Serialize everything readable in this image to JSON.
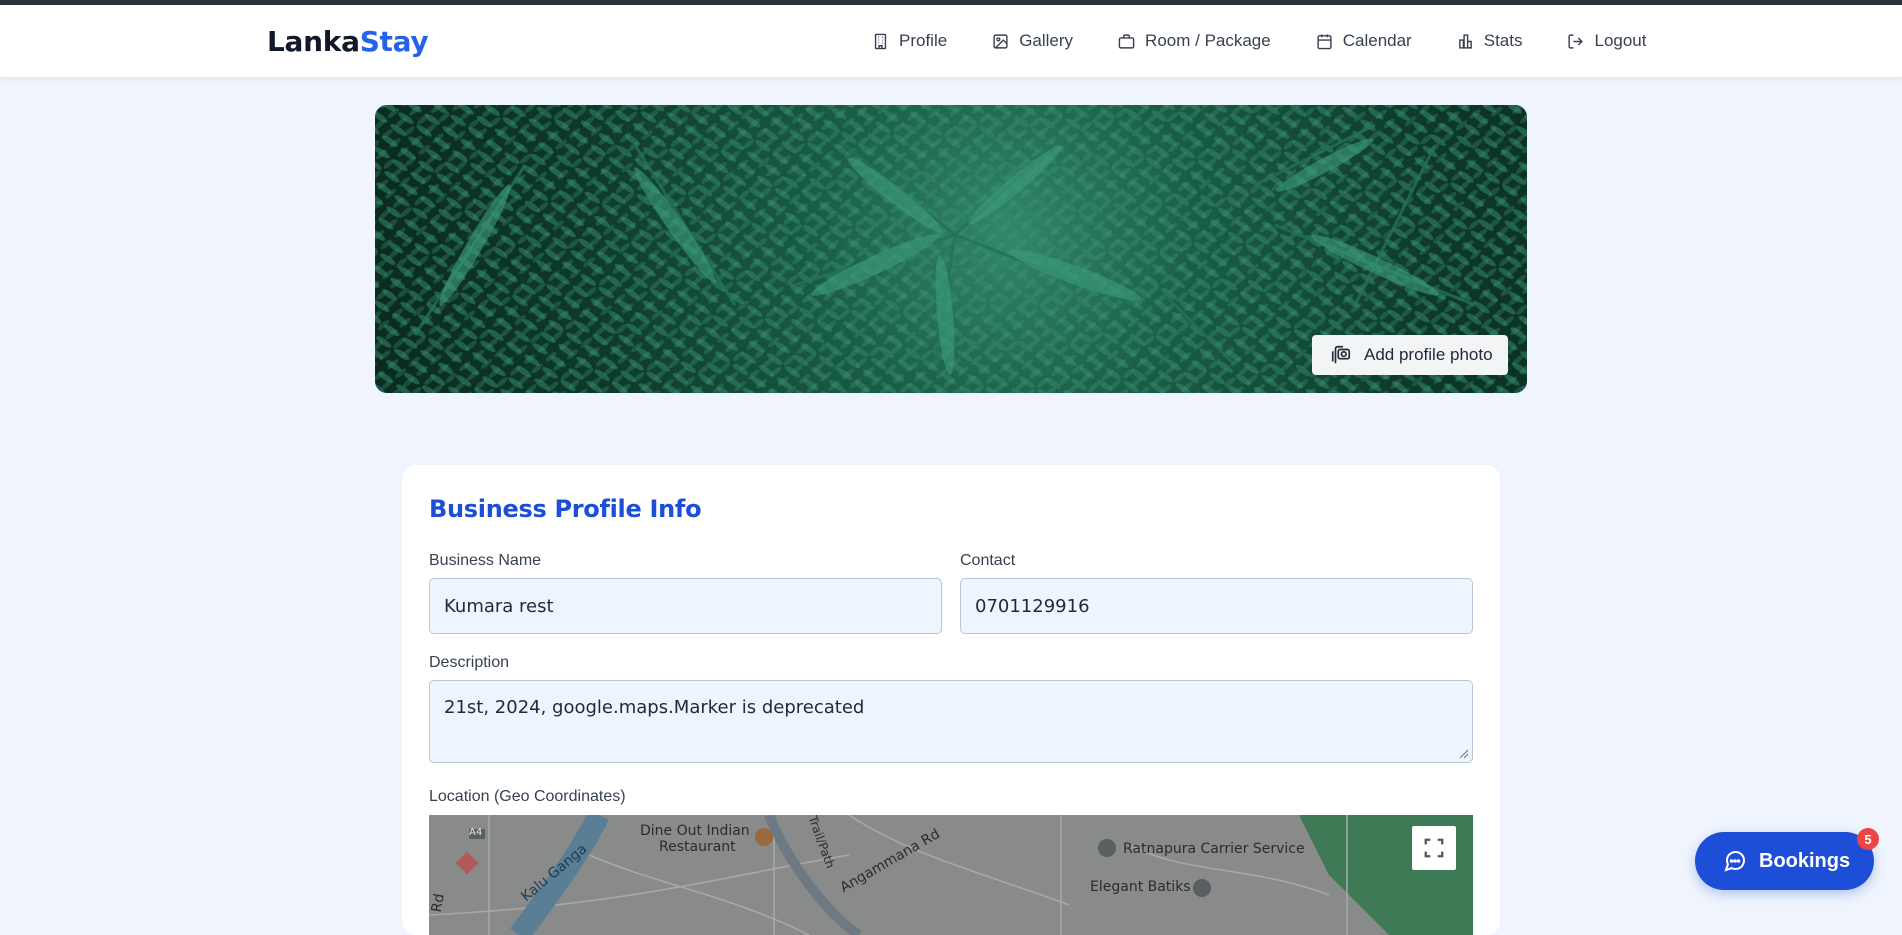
{
  "brand": {
    "part1": "Lanka",
    "part2": "Stay"
  },
  "nav": [
    {
      "label": "Profile",
      "icon": "building-icon"
    },
    {
      "label": "Gallery",
      "icon": "image-icon"
    },
    {
      "label": "Room / Package",
      "icon": "briefcase-icon"
    },
    {
      "label": "Calendar",
      "icon": "calendar-icon"
    },
    {
      "label": "Stats",
      "icon": "bar-chart-icon"
    },
    {
      "label": "Logout",
      "icon": "logout-icon"
    }
  ],
  "hero": {
    "add_photo_label": "Add profile photo"
  },
  "profile": {
    "title": "Business Profile Info",
    "business_name_label": "Business Name",
    "business_name_value": "Kumara rest",
    "contact_label": "Contact",
    "contact_value": "0701129916",
    "description_label": "Description",
    "description_value": "21st, 2024, google.maps.Marker is deprecated",
    "location_label": "Location (Geo Coordinates)"
  },
  "map": {
    "labels": {
      "road_a4": "A4",
      "river": "Kalu Ganga",
      "restaurant_line1": "Dine Out Indian",
      "restaurant_line2": "Restaurant",
      "trail": "Trail/Path",
      "road": "Angammana Rd",
      "carrier": "Ratnapura Carrier Service",
      "batiks": "Elegant Batiks",
      "rd": "Rd"
    }
  },
  "bookings": {
    "label": "Bookings",
    "count": "5"
  },
  "colors": {
    "accent": "#2563eb",
    "title": "#1d4ed8",
    "badge": "#ef4444"
  }
}
